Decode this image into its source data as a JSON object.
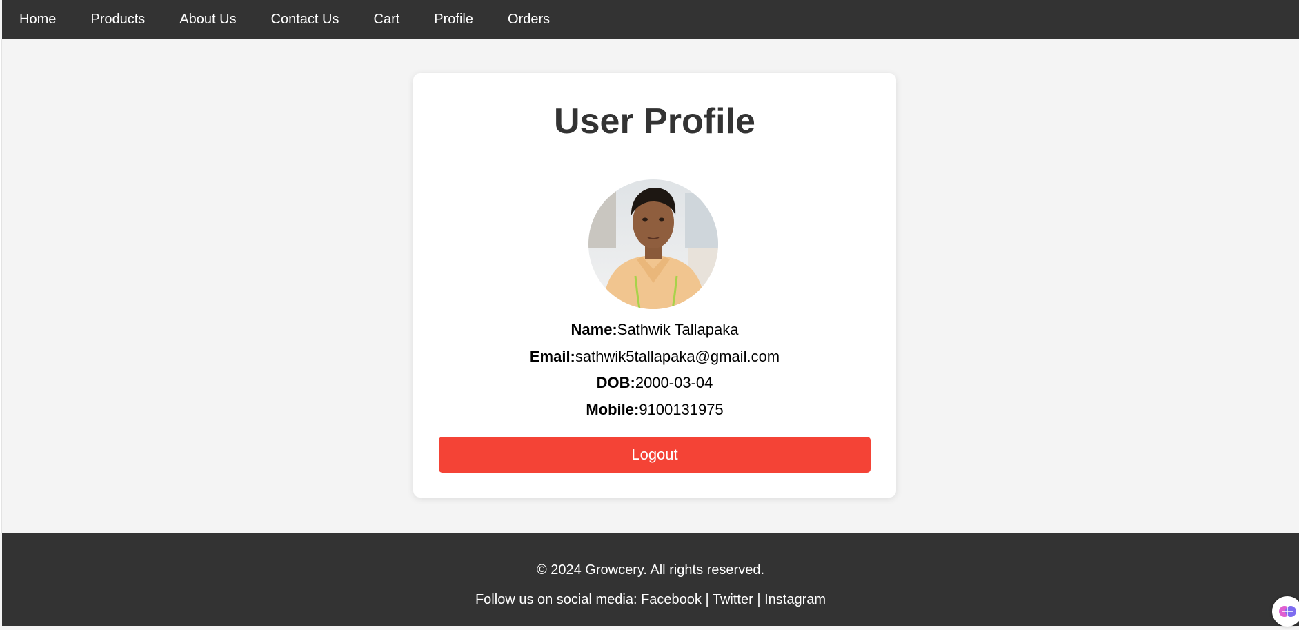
{
  "nav": {
    "items": [
      "Home",
      "Products",
      "About Us",
      "Contact Us",
      "Cart",
      "Profile",
      "Orders"
    ]
  },
  "profile": {
    "title": "User Profile",
    "avatar_icon": "user-photo",
    "fields": [
      {
        "label": "Name:",
        "value": "Sathwik Tallapaka"
      },
      {
        "label": "Email:",
        "value": "sathwik5tallapaka@gmail.com"
      },
      {
        "label": "DOB:",
        "value": "2000-03-04"
      },
      {
        "label": "Mobile:",
        "value": "9100131975"
      }
    ],
    "logout_label": "Logout"
  },
  "footer": {
    "copyright": "© 2024 Growcery. All rights reserved.",
    "follow_prefix": "Follow us on social media: ",
    "links": [
      "Facebook",
      "Twitter",
      "Instagram"
    ],
    "separator": " | "
  },
  "colors": {
    "nav_bg": "#333333",
    "page_bg": "#f4f4f4",
    "logout_bg": "#f44336"
  }
}
